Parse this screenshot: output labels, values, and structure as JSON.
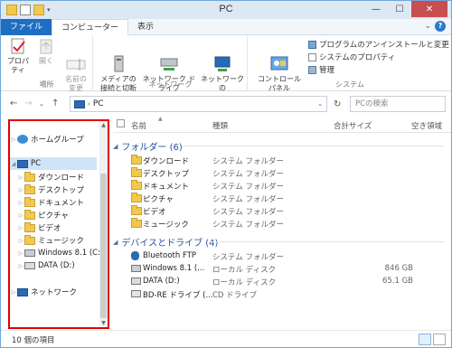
{
  "window": {
    "title": "PC"
  },
  "colors": {
    "accent": "#1e6fc2",
    "highlight": "#e00000",
    "selected": "#cfe4f7",
    "group_title": "#1e4e9c"
  },
  "tabs": [
    {
      "label": "ファイル"
    },
    {
      "label": "コンピューター"
    },
    {
      "label": "表示"
    }
  ],
  "ribbon": {
    "groups": [
      {
        "label": "場所",
        "buttons": [
          "プロパティ",
          "開く",
          "名前の\n変更"
        ]
      },
      {
        "label": "ネットワーク",
        "buttons": [
          "メディアの\n接続と切断",
          "ネットワーク ドライブ\nの割り当て",
          "ネットワークの\n場所の追加"
        ]
      },
      {
        "label": "システム",
        "buttons": [
          "コントロール パネル\nを開く"
        ],
        "small": [
          "プログラムのアンインストールと変更",
          "システムのプロパティ",
          "管理"
        ]
      }
    ]
  },
  "address": {
    "path": "PC",
    "search_placeholder": "PCの検索"
  },
  "nav": {
    "homegroup": "ホームグループ",
    "pc": "PC",
    "children": [
      "ダウンロード",
      "デスクトップ",
      "ドキュメント",
      "ピクチャ",
      "ビデオ",
      "ミュージック",
      "Windows 8.1 (C:)",
      "DATA (D:)"
    ],
    "network": "ネットワーク"
  },
  "columns": {
    "name": "名前",
    "type": "種類",
    "total": "合計サイズ",
    "free": "空き領域"
  },
  "groups": [
    {
      "title": "フォルダー (6)",
      "items": [
        {
          "name": "ダウンロード",
          "type": "システム フォルダー",
          "size": ""
        },
        {
          "name": "デスクトップ",
          "type": "システム フォルダー",
          "size": ""
        },
        {
          "name": "ドキュメント",
          "type": "システム フォルダー",
          "size": ""
        },
        {
          "name": "ピクチャ",
          "type": "システム フォルダー",
          "size": ""
        },
        {
          "name": "ビデオ",
          "type": "システム フォルダー",
          "size": ""
        },
        {
          "name": "ミュージック",
          "type": "システム フォルダー",
          "size": ""
        }
      ]
    },
    {
      "title": "デバイスとドライブ (4)",
      "items": [
        {
          "name": "Bluetooth FTP",
          "type": "システム フォルダー",
          "size": ""
        },
        {
          "name": "Windows 8.1 (...",
          "type": "ローカル ディスク",
          "size": "846 GB"
        },
        {
          "name": "DATA (D:)",
          "type": "ローカル ディスク",
          "size": "65.1 GB"
        },
        {
          "name": "BD-RE ドライブ (...",
          "type": "CD ドライブ",
          "size": ""
        }
      ]
    }
  ],
  "status": {
    "count": "10 個の項目"
  }
}
